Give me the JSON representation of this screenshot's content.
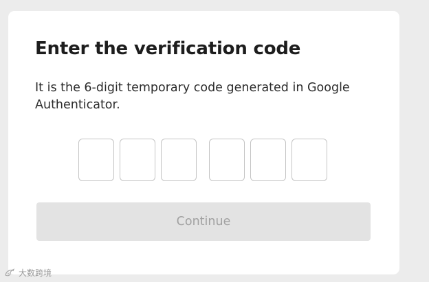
{
  "verification": {
    "title": "Enter the verification code",
    "description": "It is the 6-digit temporary code generated in Google Authenticator.",
    "code_digits": [
      "",
      "",
      "",
      "",
      "",
      ""
    ],
    "continue_label": "Continue"
  },
  "watermark": {
    "text": "大数跨境",
    "icon": "bird-logo-icon"
  },
  "colors": {
    "page_background": "#ececec",
    "card_background": "#ffffff",
    "title_text": "#1d1d1d",
    "input_border": "#c4c4c4",
    "button_disabled_background": "#e3e3e3",
    "button_disabled_text": "#a1a1a1"
  }
}
